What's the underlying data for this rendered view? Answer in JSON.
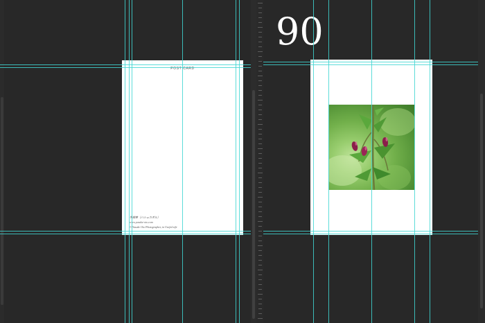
{
  "left_canvas": {
    "postcard_back": {
      "title": "POST CARD",
      "credit_name": "手綱草（ハシュカダル）",
      "credit_url": "www.yusuke-oto.com",
      "credit_copyright": "© Yusuke Oto Photographer, in Useful nife"
    }
  },
  "right_canvas": {
    "page_number": "90",
    "photo_icon": "flower-bud-photo"
  },
  "colors": {
    "background": "#282828",
    "guide": "#3fd6d2",
    "page": "#ffffff"
  }
}
